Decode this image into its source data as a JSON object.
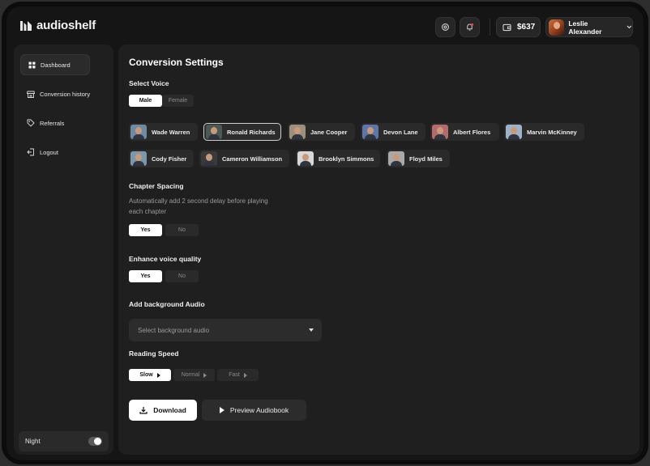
{
  "app": {
    "name": "audioshelf"
  },
  "header": {
    "balance": "$637",
    "user_name": "Leslie Alexander"
  },
  "sidebar": {
    "items": [
      {
        "label": "Dashboard",
        "icon": "grid-icon",
        "active": true
      },
      {
        "label": "Conversion history",
        "icon": "store-icon",
        "active": false
      },
      {
        "label": "Referrals",
        "icon": "tag-icon",
        "active": false
      },
      {
        "label": "Logout",
        "icon": "logout-icon",
        "active": false
      }
    ],
    "night_label": "Night",
    "night_on": true
  },
  "main": {
    "title": "Conversion Settings",
    "select_voice": {
      "label": "Select Voice",
      "gender_options": [
        "Male",
        "Female"
      ],
      "selected_gender": "Male",
      "voices": [
        "Wade Warren",
        "Ronald Richards",
        "Jane Cooper",
        "Devon Lane",
        "Albert Flores",
        "Marvin McKinney",
        "Cody Fisher",
        "Cameron Williamson",
        "Brooklyn Simmons",
        "Floyd Miles"
      ],
      "selected_voice": "Ronald Richards"
    },
    "chapter_spacing": {
      "label": "Chapter Spacing",
      "description": "Automatically add 2 second delay before playing each chapter",
      "options": [
        "Yes",
        "No"
      ],
      "selected": "Yes"
    },
    "enhance_quality": {
      "label": "Enhance voice quality",
      "options": [
        "Yes",
        "No"
      ],
      "selected": "Yes"
    },
    "background_audio": {
      "label": "Add background Audio",
      "placeholder": "Select background audio"
    },
    "reading_speed": {
      "label": "Reading Speed",
      "options": [
        "Slow",
        "Normal",
        "Fast"
      ],
      "selected": "Slow"
    },
    "actions": {
      "download": "Download",
      "preview": "Preview Audiobook"
    }
  }
}
